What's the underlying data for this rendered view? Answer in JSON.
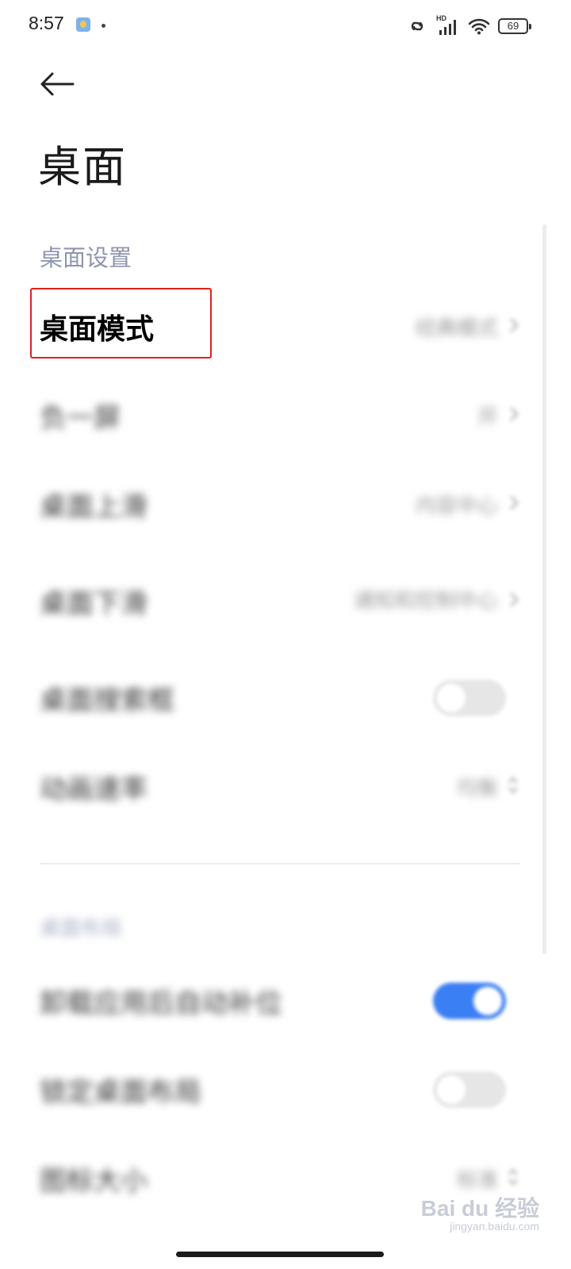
{
  "status_bar": {
    "time": "8:57",
    "app_icon": "notification-app-icon",
    "network_label": "HD",
    "battery_level": "69",
    "icons": [
      "link-icon",
      "signal-icon",
      "wifi-icon",
      "battery-icon"
    ]
  },
  "header": {
    "back_icon": "back-arrow-icon",
    "title": "桌面"
  },
  "sections": [
    {
      "title": "桌面设置",
      "items": [
        {
          "label": "桌面模式",
          "value": "经典模式",
          "control": "chevron"
        },
        {
          "label": "负一屏",
          "value": "开",
          "control": "chevron"
        },
        {
          "label": "桌面上滑",
          "value": "内容中心",
          "control": "chevron"
        },
        {
          "label": "桌面下滑",
          "value": "通知和控制中心",
          "control": "chevron"
        },
        {
          "label": "桌面搜索框",
          "value": "",
          "control": "toggle",
          "toggle_on": false
        },
        {
          "label": "动画速率",
          "value": "均衡",
          "control": "chevron"
        }
      ]
    },
    {
      "title": "桌面布局",
      "items": [
        {
          "label": "卸载应用后自动补位",
          "value": "",
          "control": "toggle",
          "toggle_on": true
        },
        {
          "label": "锁定桌面布局",
          "value": "",
          "control": "toggle",
          "toggle_on": false
        },
        {
          "label": "图标大小",
          "value": "标准",
          "control": "chevron"
        }
      ]
    }
  ],
  "annotation": {
    "highlighted_item": "桌面模式",
    "color": "#e0211d"
  },
  "watermark": {
    "logo": "Bai du 经验",
    "url": "jingyan.baidu.com"
  },
  "colors": {
    "accent": "#3b7ff5",
    "section_header": "#8e96b0",
    "value_text": "#9a9a9a",
    "highlight": "#e0211d"
  }
}
